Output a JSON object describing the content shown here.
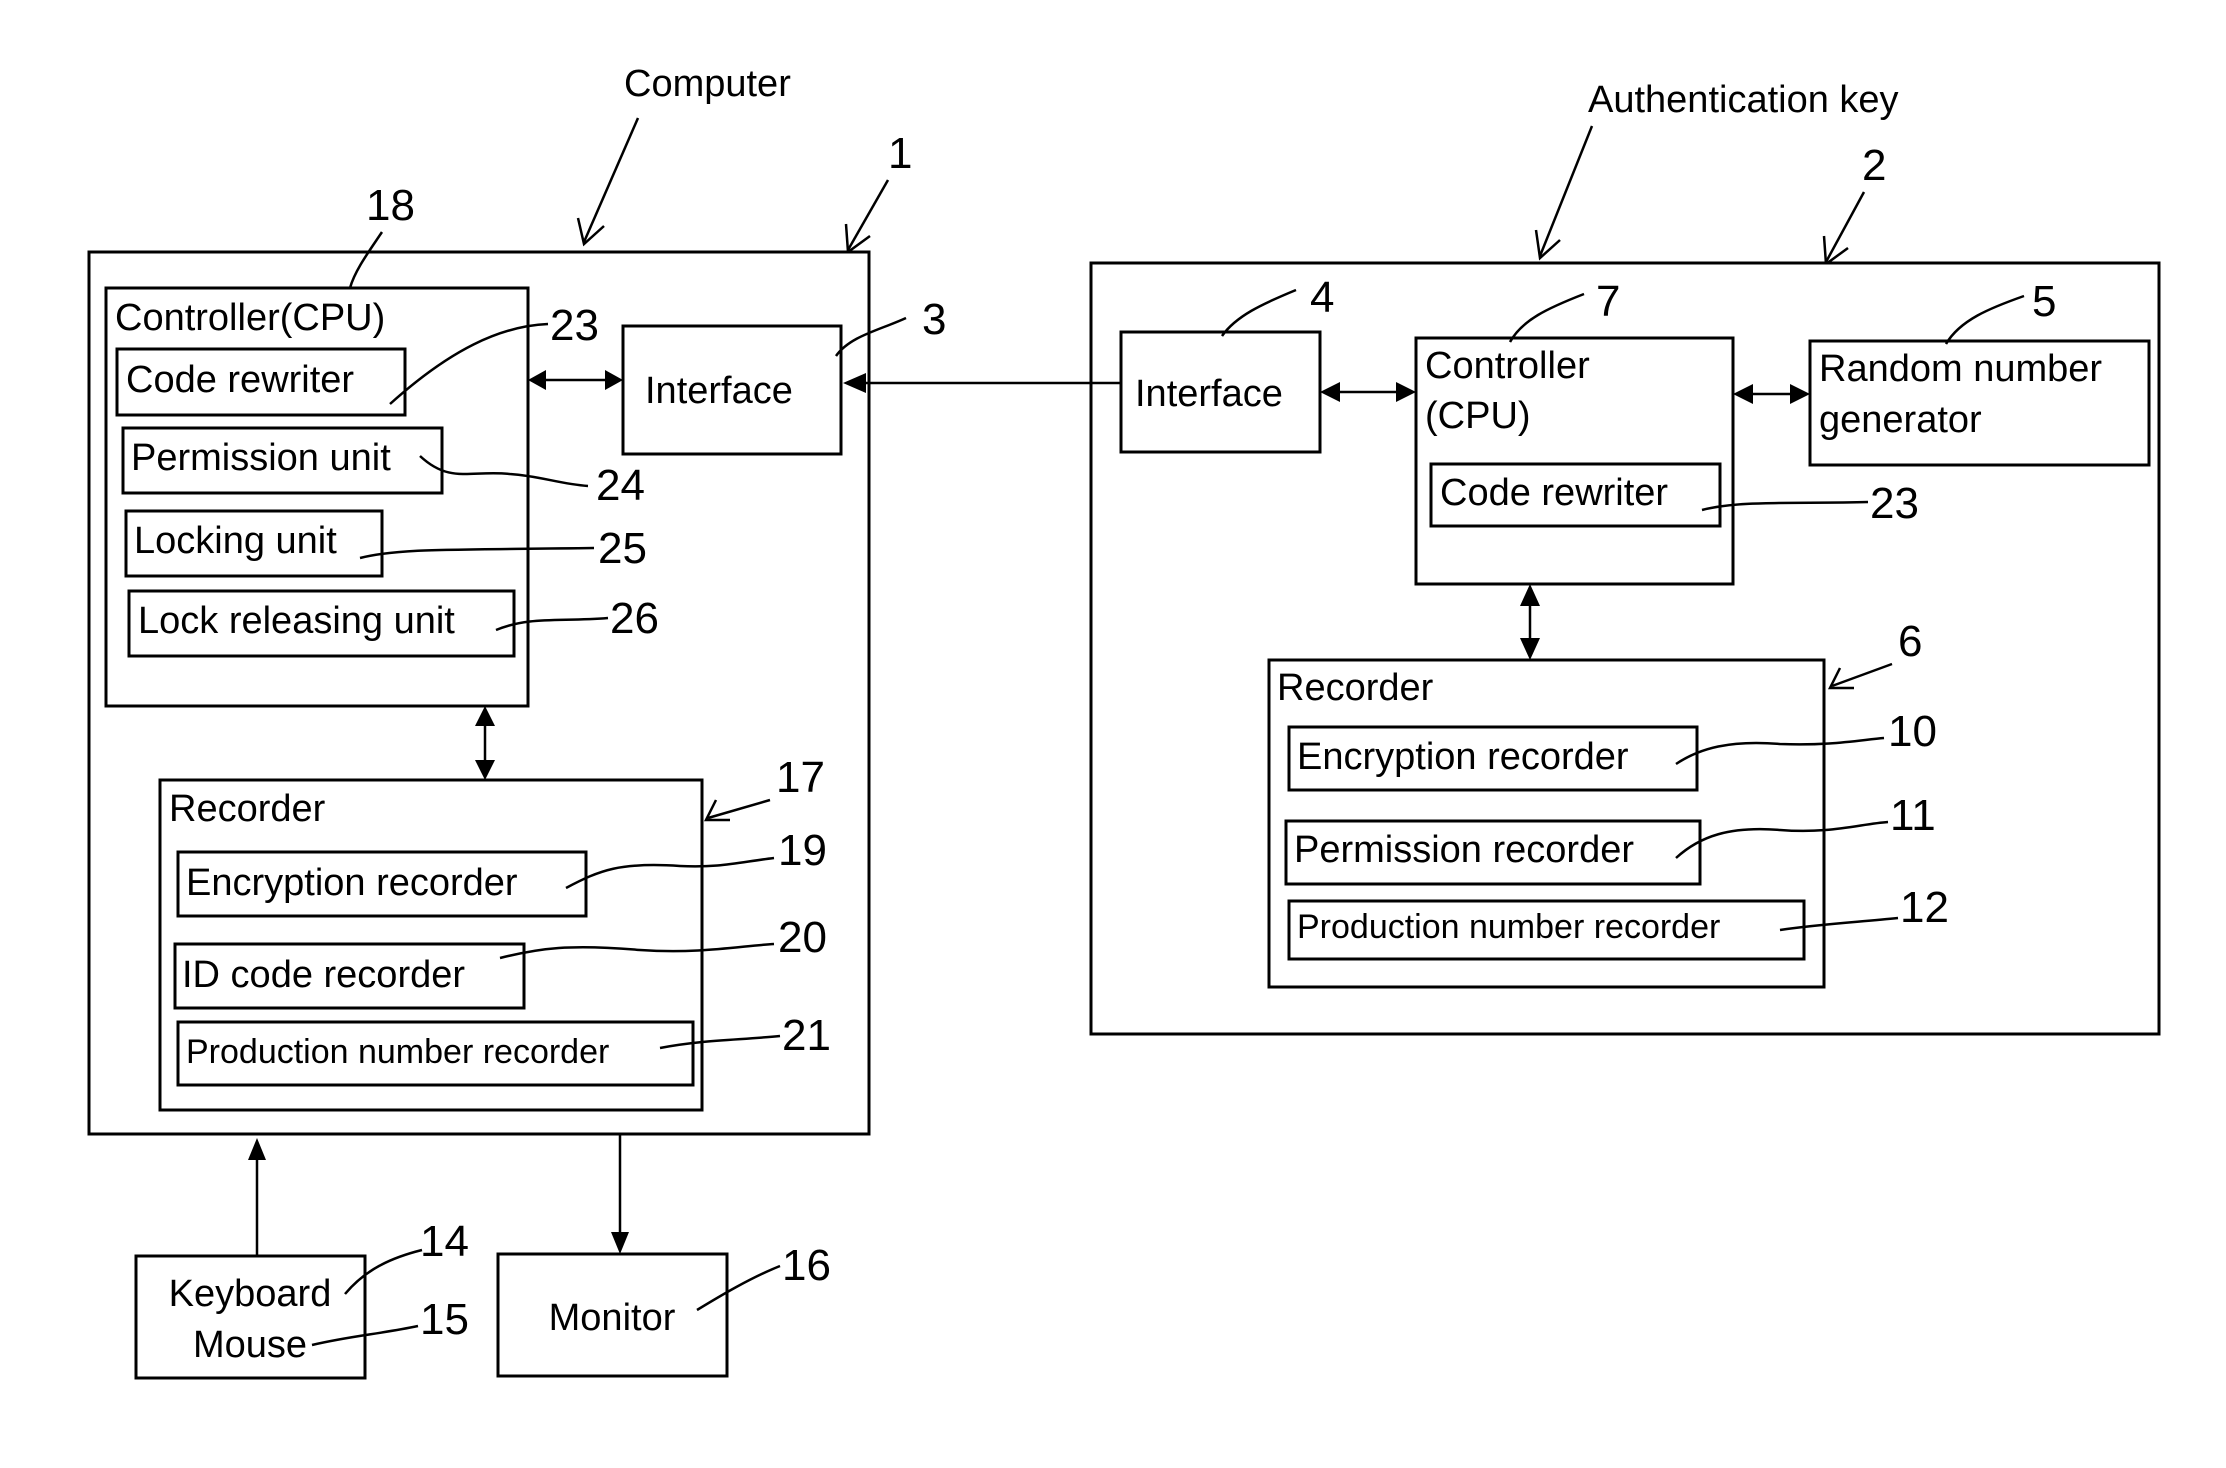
{
  "diagram": {
    "type": "block-diagram",
    "computer": {
      "title": "Computer",
      "ref": "1",
      "controller": {
        "label": "Controller(CPU)",
        "ref": "18",
        "units": [
          {
            "label": "Code rewriter",
            "ref": "23"
          },
          {
            "label": "Permission unit",
            "ref": "24"
          },
          {
            "label": "Locking unit",
            "ref": "25"
          },
          {
            "label": "Lock releasing unit",
            "ref": "26"
          }
        ]
      },
      "interface": {
        "label": "Interface",
        "ref": "3"
      },
      "recorder": {
        "label": "Recorder",
        "ref": "17",
        "units": [
          {
            "label": "Encryption recorder",
            "ref": "19"
          },
          {
            "label": "ID code recorder",
            "ref": "20"
          },
          {
            "label": "Production number recorder",
            "ref": "21"
          }
        ]
      }
    },
    "peripherals": {
      "keyboard": {
        "label": "Keyboard",
        "ref": "14"
      },
      "mouse": {
        "label": "Mouse",
        "ref": "15"
      },
      "monitor": {
        "label": "Monitor",
        "ref": "16"
      }
    },
    "auth_key": {
      "title": "Authentication key",
      "ref": "2",
      "interface": {
        "label": "Interface",
        "ref": "4"
      },
      "controller": {
        "label_line1": "Controller",
        "label_line2": "(CPU)",
        "ref": "7",
        "code_rewriter": {
          "label": "Code rewriter",
          "ref": "23"
        }
      },
      "random": {
        "label_line1": "Random number",
        "label_line2": "generator",
        "ref": "5"
      },
      "recorder": {
        "label": "Recorder",
        "ref": "6",
        "units": [
          {
            "label": "Encryption recorder",
            "ref": "10"
          },
          {
            "label": "Permission recorder",
            "ref": "11"
          },
          {
            "label": "Production number recorder",
            "ref": "12"
          }
        ]
      }
    },
    "connections": [
      {
        "from": "Controller(CPU) 18",
        "to": "Interface 3",
        "direction": "bidirectional"
      },
      {
        "from": "Interface 4",
        "to": "Interface 3",
        "direction": "one-way"
      },
      {
        "from": "Interface 4",
        "to": "Controller 7",
        "direction": "bidirectional"
      },
      {
        "from": "Controller 7",
        "to": "Random number generator 5",
        "direction": "bidirectional"
      },
      {
        "from": "Controller 7",
        "to": "Recorder 6",
        "direction": "bidirectional"
      },
      {
        "from": "Controller(CPU) 18",
        "to": "Recorder 17",
        "direction": "bidirectional"
      },
      {
        "from": "Keyboard/Mouse",
        "to": "Computer 1",
        "direction": "one-way"
      },
      {
        "from": "Computer 1",
        "to": "Monitor 16",
        "direction": "one-way"
      }
    ]
  }
}
